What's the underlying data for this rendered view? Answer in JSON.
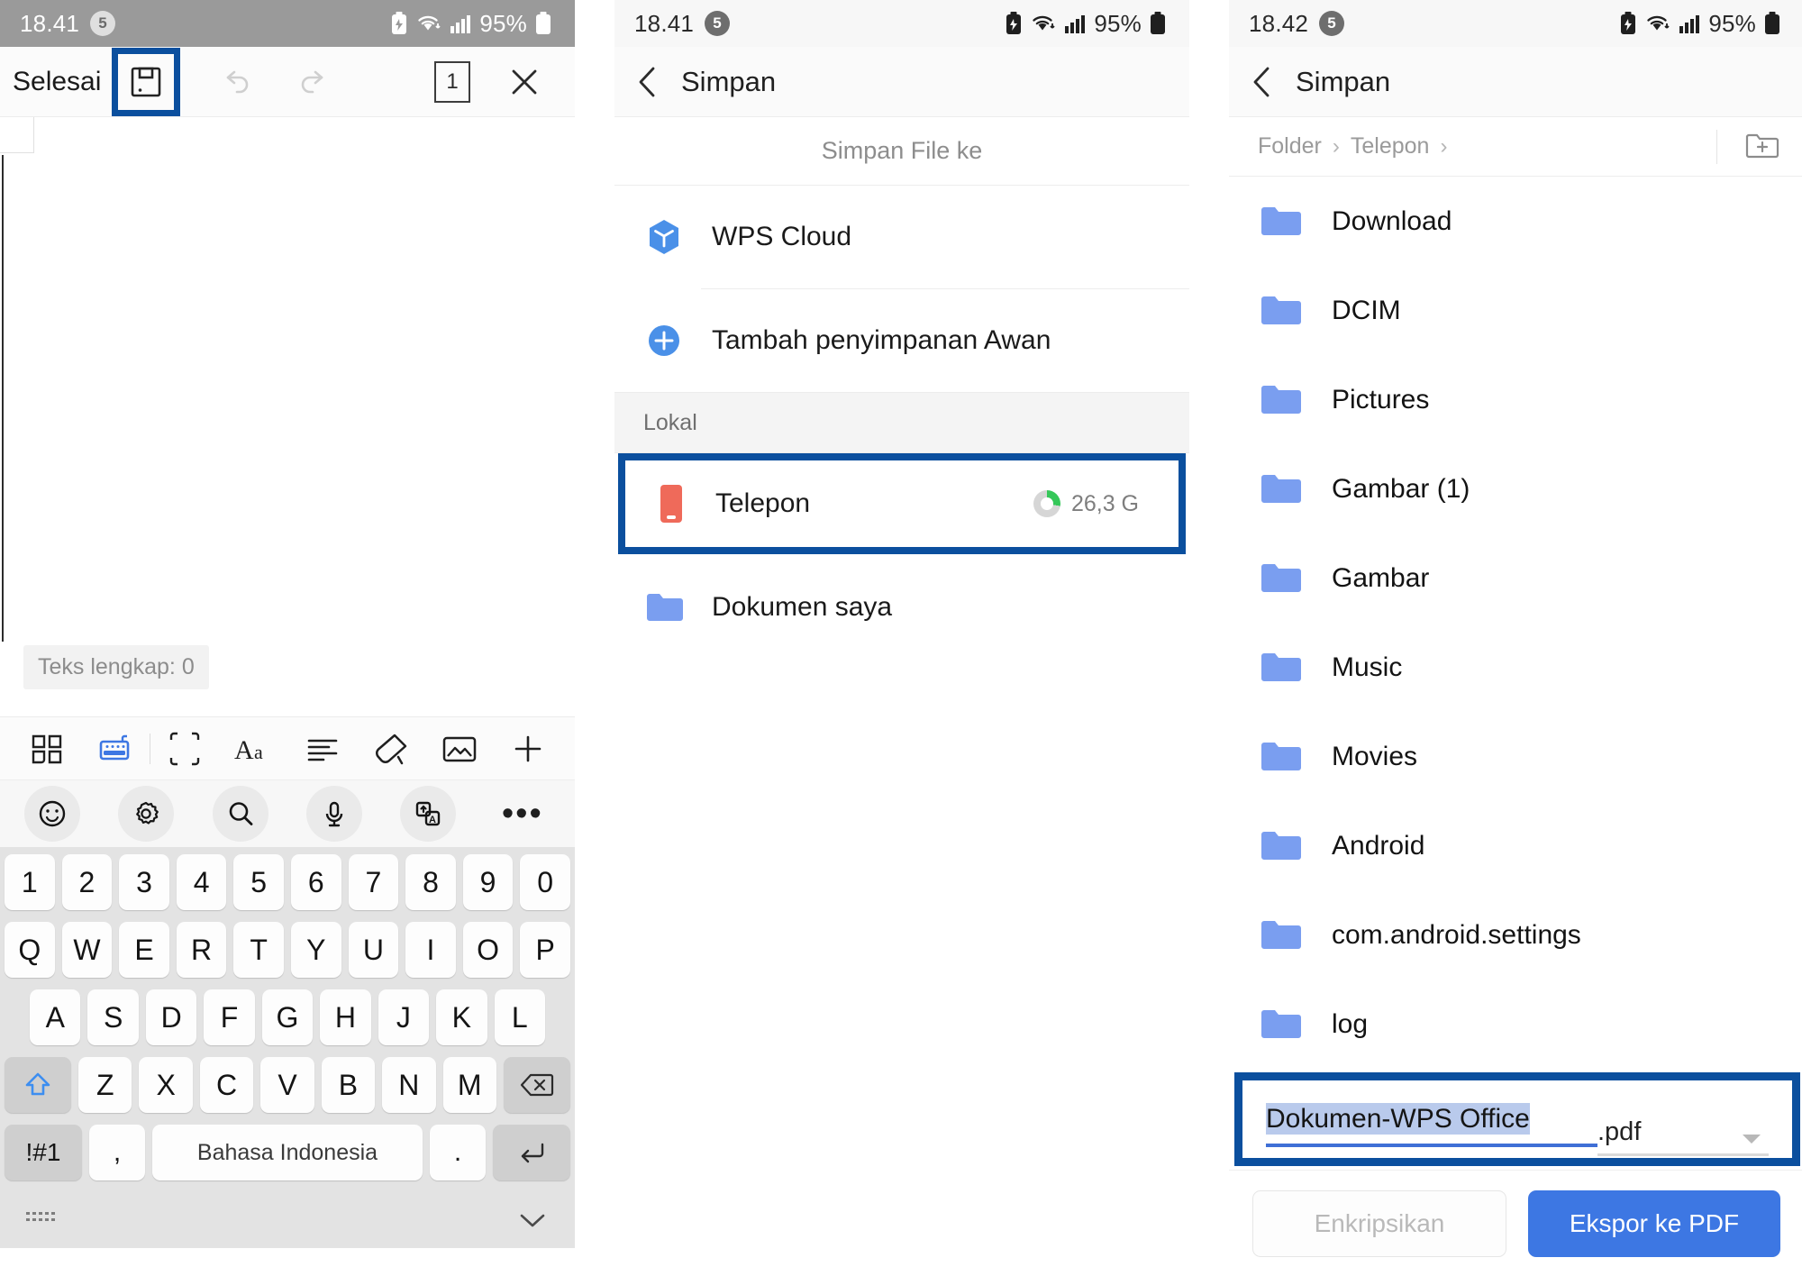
{
  "editor": {
    "status": {
      "time": "18.41",
      "notif_count": "5",
      "battery": "95%"
    },
    "toolbar": {
      "done_label": "Selesai",
      "save_icon": "floppy-save-icon",
      "undo_icon": "undo-icon",
      "redo_icon": "redo-icon",
      "page_count": "1",
      "close_icon": "close-icon"
    },
    "canvas": {
      "word_count": "Teks lengkap: 0"
    },
    "format_row1": [
      {
        "name": "grid-apps-icon"
      },
      {
        "name": "keyboard-icon"
      },
      {
        "name": "select-frame-icon"
      },
      {
        "name": "font-size-icon"
      },
      {
        "name": "align-left-icon"
      },
      {
        "name": "highlighter-icon"
      },
      {
        "name": "image-icon"
      },
      {
        "name": "plus-icon"
      }
    ],
    "format_row2": [
      {
        "name": "emoji-icon"
      },
      {
        "name": "gear-icon"
      },
      {
        "name": "search-icon"
      },
      {
        "name": "microphone-icon"
      },
      {
        "name": "translate-icon"
      },
      {
        "name": "more-icon"
      }
    ],
    "keyboard": {
      "row_numbers": [
        "1",
        "2",
        "3",
        "4",
        "5",
        "6",
        "7",
        "8",
        "9",
        "0"
      ],
      "row_top": [
        "Q",
        "W",
        "E",
        "R",
        "T",
        "Y",
        "U",
        "I",
        "O",
        "P"
      ],
      "row_home": [
        "A",
        "S",
        "D",
        "F",
        "G",
        "H",
        "J",
        "K",
        "L"
      ],
      "row_bottom": [
        "Z",
        "X",
        "C",
        "V",
        "B",
        "N",
        "M"
      ],
      "shift_icon": "shift-up-icon",
      "backspace_icon": "backspace-icon",
      "symbols_label": "!#1",
      "comma_label": ",",
      "space_label": "Bahasa Indonesia",
      "period_label": ".",
      "enter_icon": "enter-icon",
      "kbd_toggle_icon": "keyboard-hide-icon",
      "collapse_icon": "chevron-down-icon"
    }
  },
  "save_sheet": {
    "status": {
      "time": "18.41",
      "notif_count": "5",
      "battery": "95%"
    },
    "nav": {
      "back_icon": "chevron-left-icon",
      "title": "Simpan"
    },
    "header": "Simpan File ke",
    "cloud_items": [
      {
        "label": "WPS Cloud",
        "icon": "wps-cloud-icon"
      },
      {
        "label": "Tambah penyimpanan Awan",
        "icon": "plus-circle-icon"
      }
    ],
    "local_section": "Lokal",
    "local_items": [
      {
        "label": "Telepon",
        "icon": "phone-storage-icon",
        "size": "26,3 G",
        "highlighted": true
      },
      {
        "label": "Dokumen saya",
        "icon": "folder-icon",
        "size": "",
        "highlighted": false
      }
    ]
  },
  "browser": {
    "status": {
      "time": "18.42",
      "notif_count": "5",
      "battery": "95%"
    },
    "nav": {
      "back_icon": "chevron-left-icon",
      "title": "Simpan"
    },
    "breadcrumb": [
      "Folder",
      "Telepon"
    ],
    "new_folder_icon": "new-folder-icon",
    "folders": [
      {
        "label": "Download"
      },
      {
        "label": "DCIM"
      },
      {
        "label": "Pictures"
      },
      {
        "label": "Gambar (1)"
      },
      {
        "label": "Gambar"
      },
      {
        "label": "Music"
      },
      {
        "label": "Movies"
      },
      {
        "label": "Android"
      },
      {
        "label": "com.android.settings"
      },
      {
        "label": "log"
      }
    ],
    "filename": {
      "value": "Dokumen-WPS Office",
      "extension": ".pdf",
      "dropdown_icon": "chevron-down-icon"
    },
    "actions": {
      "encrypt_label": "Enkripsikan",
      "export_label": "Ekspor ke PDF"
    }
  },
  "colors": {
    "highlight": "#0b4f9e",
    "primary": "#3d77e3",
    "folder_blue": "#7a9ef0",
    "phone_red": "#ef6a5a",
    "storage_green": "#35c759"
  }
}
